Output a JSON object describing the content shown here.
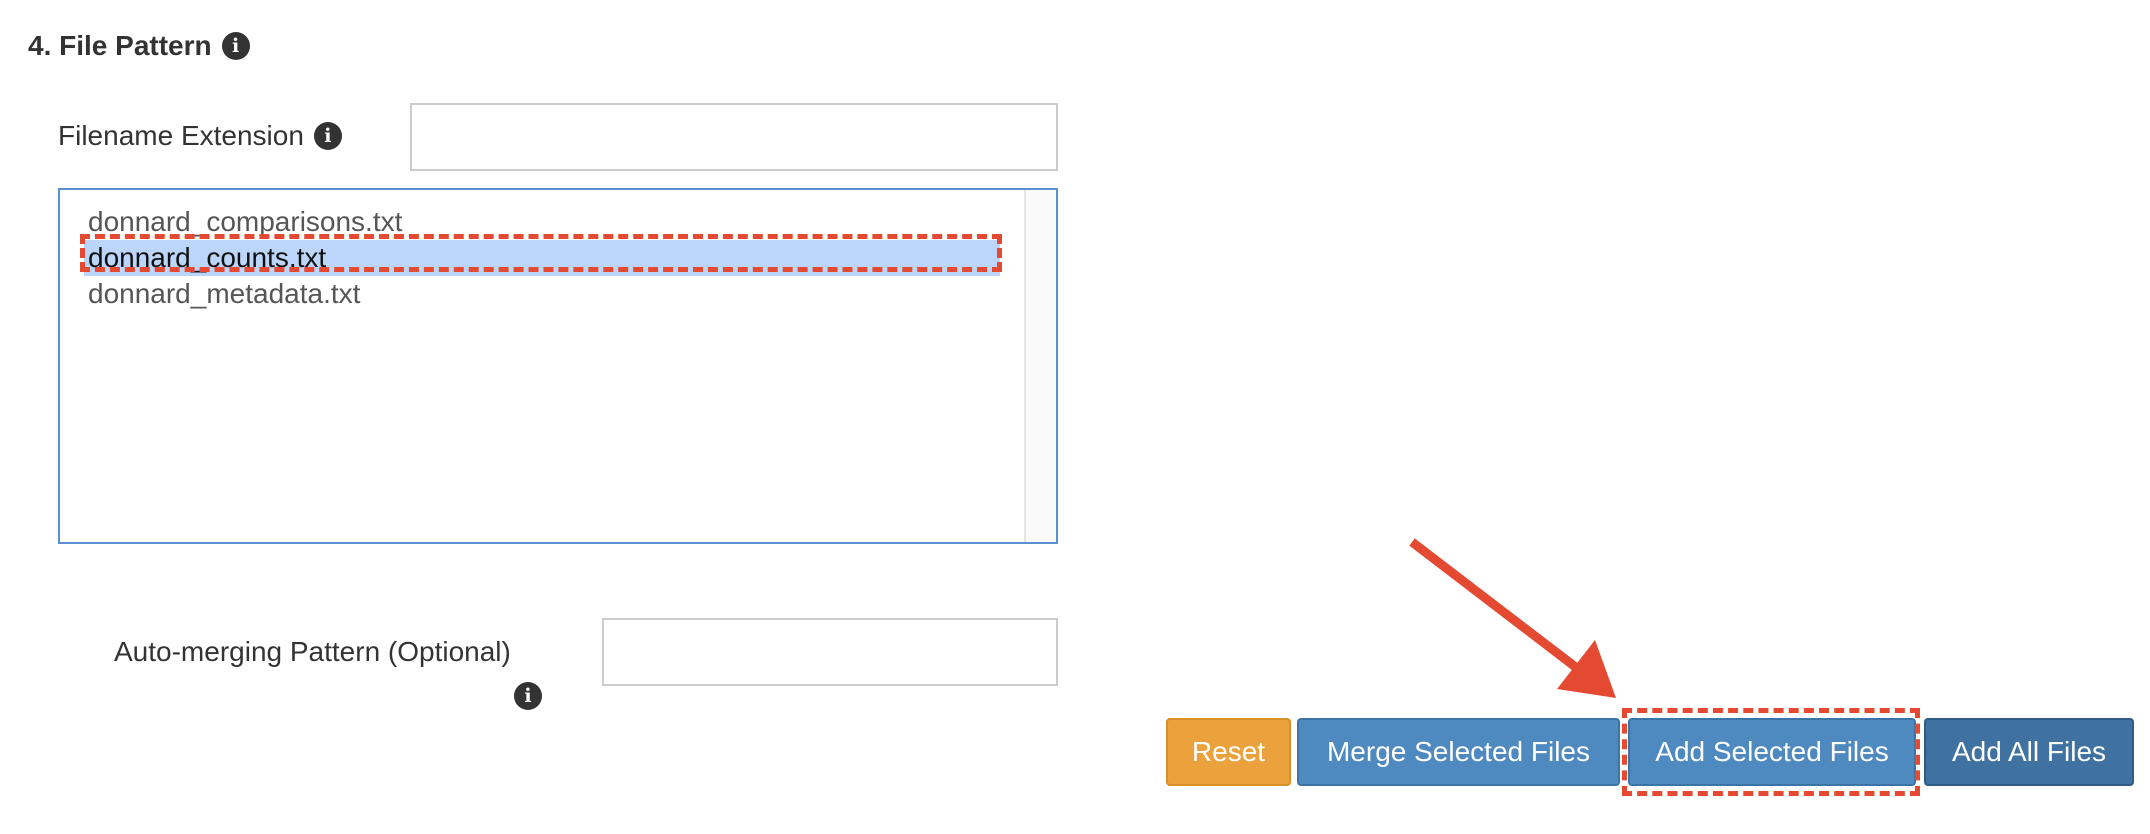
{
  "section": {
    "title": "4. File Pattern",
    "info_icon": "info-circle-icon"
  },
  "filename_extension": {
    "label": "Filename Extension",
    "value": "",
    "info_icon": "info-circle-icon"
  },
  "file_list": {
    "items": [
      {
        "name": "donnard_comparisons.txt",
        "selected": false
      },
      {
        "name": "donnard_counts.txt",
        "selected": true
      },
      {
        "name": "donnard_metadata.txt",
        "selected": false
      }
    ]
  },
  "auto_merging": {
    "label": "Auto-merging Pattern (Optional)",
    "value": "",
    "info_icon": "info-circle-icon"
  },
  "buttons": {
    "reset": "Reset",
    "merge_selected": "Merge Selected Files",
    "add_selected": "Add Selected Files",
    "add_all": "Add All Files"
  },
  "annotation": {
    "color": "#e44a32",
    "arrow_icon": "red-arrow-annotation"
  },
  "colors": {
    "warning": "#eca23c",
    "primary": "#4e8ac0",
    "dark_primary": "#3f72a0",
    "selection": "#bcd6fb",
    "list_border": "#5a8fd1"
  }
}
